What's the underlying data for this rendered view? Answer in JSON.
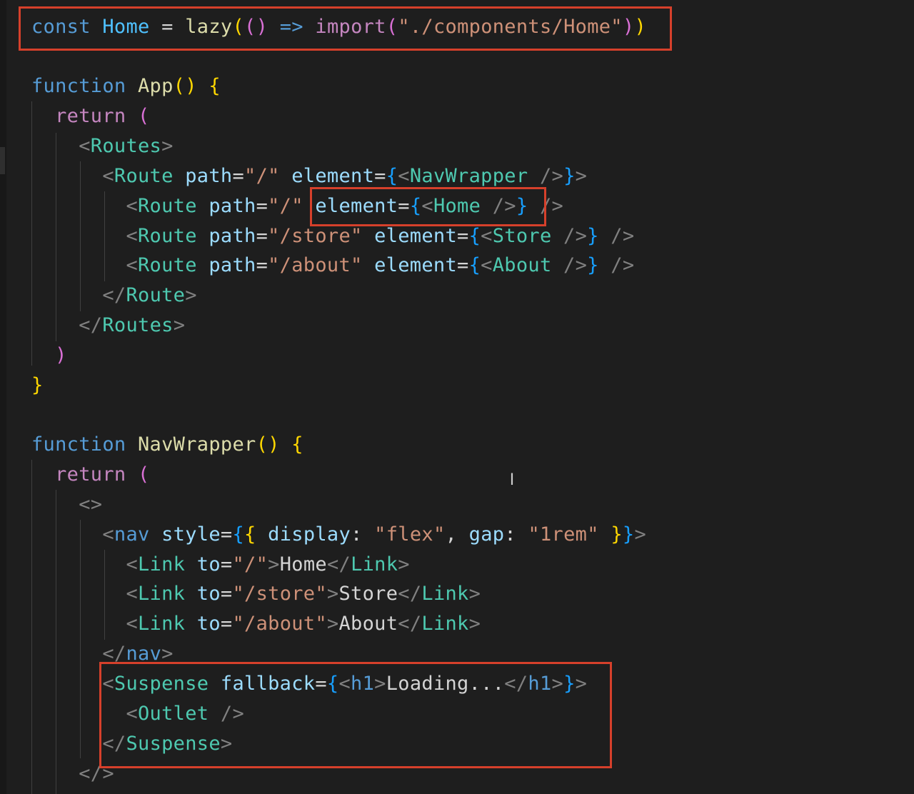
{
  "editor": {
    "lines": [
      {
        "id": "l1",
        "tokens": [
          {
            "t": "const ",
            "c": "kw"
          },
          {
            "t": "Home",
            "c": "vr"
          },
          {
            "t": " = ",
            "c": "txt"
          },
          {
            "t": "lazy",
            "c": "fn"
          },
          {
            "t": "(",
            "c": "b1"
          },
          {
            "t": "()",
            "c": "b2"
          },
          {
            "t": " => ",
            "c": "kw"
          },
          {
            "t": "import",
            "c": "ctl"
          },
          {
            "t": "(",
            "c": "b2"
          },
          {
            "t": "\"./components/Home\"",
            "c": "str"
          },
          {
            "t": ")",
            "c": "b2"
          },
          {
            "t": ")",
            "c": "b1"
          }
        ]
      },
      {
        "id": "l2",
        "tokens": []
      },
      {
        "id": "l3",
        "tokens": [
          {
            "t": "function ",
            "c": "kw"
          },
          {
            "t": "App",
            "c": "fn"
          },
          {
            "t": "() ",
            "c": "b1"
          },
          {
            "t": "{",
            "c": "b1"
          }
        ]
      },
      {
        "id": "l4",
        "tokens": [
          {
            "t": "  return ",
            "c": "ctl"
          },
          {
            "t": "(",
            "c": "b2"
          }
        ]
      },
      {
        "id": "l5",
        "tokens": [
          {
            "t": "    <",
            "c": "punct"
          },
          {
            "t": "Routes",
            "c": "tag"
          },
          {
            "t": ">",
            "c": "punct"
          }
        ]
      },
      {
        "id": "l6",
        "tokens": [
          {
            "t": "      <",
            "c": "punct"
          },
          {
            "t": "Route",
            "c": "tag"
          },
          {
            "t": " path",
            "c": "attr"
          },
          {
            "t": "=",
            "c": "txt"
          },
          {
            "t": "\"/\"",
            "c": "str"
          },
          {
            "t": " element",
            "c": "attr"
          },
          {
            "t": "=",
            "c": "txt"
          },
          {
            "t": "{",
            "c": "b3"
          },
          {
            "t": "<",
            "c": "punct"
          },
          {
            "t": "NavWrapper",
            "c": "tag"
          },
          {
            "t": " />",
            "c": "punct"
          },
          {
            "t": "}",
            "c": "b3"
          },
          {
            "t": ">",
            "c": "punct"
          }
        ]
      },
      {
        "id": "l7",
        "tokens": [
          {
            "t": "        <",
            "c": "punct"
          },
          {
            "t": "Route",
            "c": "tag"
          },
          {
            "t": " path",
            "c": "attr"
          },
          {
            "t": "=",
            "c": "txt"
          },
          {
            "t": "\"/\"",
            "c": "str"
          },
          {
            "t": " element",
            "c": "attr"
          },
          {
            "t": "=",
            "c": "txt"
          },
          {
            "t": "{",
            "c": "b3"
          },
          {
            "t": "<",
            "c": "punct"
          },
          {
            "t": "Home",
            "c": "tag"
          },
          {
            "t": " />",
            "c": "punct"
          },
          {
            "t": "}",
            "c": "b3"
          },
          {
            "t": " />",
            "c": "punct"
          }
        ]
      },
      {
        "id": "l8",
        "tokens": [
          {
            "t": "        <",
            "c": "punct"
          },
          {
            "t": "Route",
            "c": "tag"
          },
          {
            "t": " path",
            "c": "attr"
          },
          {
            "t": "=",
            "c": "txt"
          },
          {
            "t": "\"/store\"",
            "c": "str"
          },
          {
            "t": " element",
            "c": "attr"
          },
          {
            "t": "=",
            "c": "txt"
          },
          {
            "t": "{",
            "c": "b3"
          },
          {
            "t": "<",
            "c": "punct"
          },
          {
            "t": "Store",
            "c": "tag"
          },
          {
            "t": " />",
            "c": "punct"
          },
          {
            "t": "}",
            "c": "b3"
          },
          {
            "t": " />",
            "c": "punct"
          }
        ]
      },
      {
        "id": "l9",
        "tokens": [
          {
            "t": "        <",
            "c": "punct"
          },
          {
            "t": "Route",
            "c": "tag"
          },
          {
            "t": " path",
            "c": "attr"
          },
          {
            "t": "=",
            "c": "txt"
          },
          {
            "t": "\"/about\"",
            "c": "str"
          },
          {
            "t": " element",
            "c": "attr"
          },
          {
            "t": "=",
            "c": "txt"
          },
          {
            "t": "{",
            "c": "b3"
          },
          {
            "t": "<",
            "c": "punct"
          },
          {
            "t": "About",
            "c": "tag"
          },
          {
            "t": " />",
            "c": "punct"
          },
          {
            "t": "}",
            "c": "b3"
          },
          {
            "t": " />",
            "c": "punct"
          }
        ]
      },
      {
        "id": "l10",
        "tokens": [
          {
            "t": "      </",
            "c": "punct"
          },
          {
            "t": "Route",
            "c": "tag"
          },
          {
            "t": ">",
            "c": "punct"
          }
        ]
      },
      {
        "id": "l11",
        "tokens": [
          {
            "t": "    </",
            "c": "punct"
          },
          {
            "t": "Routes",
            "c": "tag"
          },
          {
            "t": ">",
            "c": "punct"
          }
        ]
      },
      {
        "id": "l12",
        "tokens": [
          {
            "t": "  )",
            "c": "b2"
          }
        ]
      },
      {
        "id": "l13",
        "tokens": [
          {
            "t": "}",
            "c": "b1"
          }
        ]
      },
      {
        "id": "l14",
        "tokens": []
      },
      {
        "id": "l15",
        "tokens": [
          {
            "t": "function ",
            "c": "kw"
          },
          {
            "t": "NavWrapper",
            "c": "fn"
          },
          {
            "t": "() ",
            "c": "b1"
          },
          {
            "t": "{",
            "c": "b1"
          }
        ]
      },
      {
        "id": "l16",
        "tokens": [
          {
            "t": "  return ",
            "c": "ctl"
          },
          {
            "t": "(",
            "c": "b2"
          }
        ]
      },
      {
        "id": "l17",
        "tokens": [
          {
            "t": "    <>",
            "c": "punct"
          }
        ]
      },
      {
        "id": "l18",
        "tokens": [
          {
            "t": "      <",
            "c": "punct"
          },
          {
            "t": "nav",
            "c": "kw"
          },
          {
            "t": " style",
            "c": "attr"
          },
          {
            "t": "=",
            "c": "txt"
          },
          {
            "t": "{",
            "c": "b3"
          },
          {
            "t": "{",
            "c": "b1"
          },
          {
            "t": " display",
            "c": "attr"
          },
          {
            "t": ": ",
            "c": "txt"
          },
          {
            "t": "\"flex\"",
            "c": "str"
          },
          {
            "t": ", ",
            "c": "txt"
          },
          {
            "t": "gap",
            "c": "attr"
          },
          {
            "t": ": ",
            "c": "txt"
          },
          {
            "t": "\"1rem\"",
            "c": "str"
          },
          {
            "t": " }",
            "c": "b1"
          },
          {
            "t": "}",
            "c": "b3"
          },
          {
            "t": ">",
            "c": "punct"
          }
        ]
      },
      {
        "id": "l19",
        "tokens": [
          {
            "t": "        <",
            "c": "punct"
          },
          {
            "t": "Link",
            "c": "tag"
          },
          {
            "t": " to",
            "c": "attr"
          },
          {
            "t": "=",
            "c": "txt"
          },
          {
            "t": "\"/\"",
            "c": "str"
          },
          {
            "t": ">",
            "c": "punct"
          },
          {
            "t": "Home",
            "c": "txt"
          },
          {
            "t": "</",
            "c": "punct"
          },
          {
            "t": "Link",
            "c": "tag"
          },
          {
            "t": ">",
            "c": "punct"
          }
        ]
      },
      {
        "id": "l20",
        "tokens": [
          {
            "t": "        <",
            "c": "punct"
          },
          {
            "t": "Link",
            "c": "tag"
          },
          {
            "t": " to",
            "c": "attr"
          },
          {
            "t": "=",
            "c": "txt"
          },
          {
            "t": "\"/store\"",
            "c": "str"
          },
          {
            "t": ">",
            "c": "punct"
          },
          {
            "t": "Store",
            "c": "txt"
          },
          {
            "t": "</",
            "c": "punct"
          },
          {
            "t": "Link",
            "c": "tag"
          },
          {
            "t": ">",
            "c": "punct"
          }
        ]
      },
      {
        "id": "l21",
        "tokens": [
          {
            "t": "        <",
            "c": "punct"
          },
          {
            "t": "Link",
            "c": "tag"
          },
          {
            "t": " to",
            "c": "attr"
          },
          {
            "t": "=",
            "c": "txt"
          },
          {
            "t": "\"/about\"",
            "c": "str"
          },
          {
            "t": ">",
            "c": "punct"
          },
          {
            "t": "About",
            "c": "txt"
          },
          {
            "t": "</",
            "c": "punct"
          },
          {
            "t": "Link",
            "c": "tag"
          },
          {
            "t": ">",
            "c": "punct"
          }
        ]
      },
      {
        "id": "l22",
        "tokens": [
          {
            "t": "      </",
            "c": "punct"
          },
          {
            "t": "nav",
            "c": "kw"
          },
          {
            "t": ">",
            "c": "punct"
          }
        ]
      },
      {
        "id": "l23",
        "tokens": [
          {
            "t": "      <",
            "c": "punct"
          },
          {
            "t": "Suspense",
            "c": "tag"
          },
          {
            "t": " fallback",
            "c": "attr"
          },
          {
            "t": "=",
            "c": "txt"
          },
          {
            "t": "{",
            "c": "b3"
          },
          {
            "t": "<",
            "c": "punct"
          },
          {
            "t": "h1",
            "c": "kw"
          },
          {
            "t": ">",
            "c": "punct"
          },
          {
            "t": "Loading...",
            "c": "txt"
          },
          {
            "t": "</",
            "c": "punct"
          },
          {
            "t": "h1",
            "c": "kw"
          },
          {
            "t": ">",
            "c": "punct"
          },
          {
            "t": "}",
            "c": "b3"
          },
          {
            "t": ">",
            "c": "punct"
          }
        ]
      },
      {
        "id": "l24",
        "tokens": [
          {
            "t": "        <",
            "c": "punct"
          },
          {
            "t": "Outlet",
            "c": "tag"
          },
          {
            "t": " />",
            "c": "punct"
          }
        ]
      },
      {
        "id": "l25",
        "tokens": [
          {
            "t": "      </",
            "c": "punct"
          },
          {
            "t": "Suspense",
            "c": "tag"
          },
          {
            "t": ">",
            "c": "punct"
          }
        ]
      },
      {
        "id": "l26",
        "tokens": [
          {
            "t": "    </>",
            "c": "punct"
          }
        ]
      }
    ]
  },
  "colors": {
    "background": "#1e1e1e",
    "highlight_box": "#d6402b",
    "keyword": "#569cd6",
    "control": "#c586c0",
    "variable": "#4fc1ff",
    "function": "#dcdcaa",
    "string": "#ce9178",
    "jsx_tag": "#4ec9b0",
    "attribute": "#9cdcfe",
    "bracket_1": "#ffd700",
    "bracket_2": "#da70d6",
    "bracket_3": "#179fff"
  },
  "annotations": {
    "highlights": [
      "lazy-import-line",
      "home-element-prop",
      "suspense-block"
    ]
  }
}
